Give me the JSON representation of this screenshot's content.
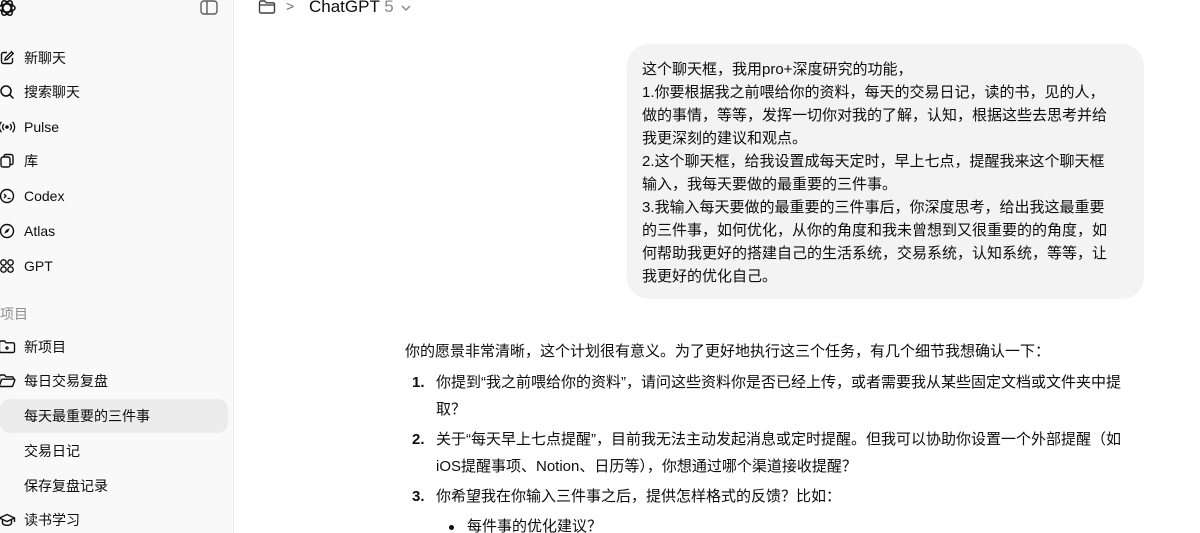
{
  "header": {
    "model_name": "ChatGPT",
    "model_version": "5",
    "breadcrumb_separator": ">"
  },
  "sidebar": {
    "nav": [
      {
        "label": "新聊天",
        "icon": "new-chat-icon"
      },
      {
        "label": "搜索聊天",
        "icon": "search-icon"
      },
      {
        "label": "Pulse",
        "icon": "pulse-icon"
      },
      {
        "label": "库",
        "icon": "library-icon"
      },
      {
        "label": "Codex",
        "icon": "codex-icon"
      },
      {
        "label": "Atlas",
        "icon": "atlas-icon"
      },
      {
        "label": "GPT",
        "icon": "gpt-icon"
      }
    ],
    "projects_heading": "项目",
    "projects": [
      {
        "label": "新项目",
        "icon": "new-project-icon"
      },
      {
        "label": "每日交易复盘",
        "icon": "folder-open-icon"
      },
      {
        "label": "每天最重要的三件事",
        "active": true
      },
      {
        "label": "交易日记"
      },
      {
        "label": "保存复盘记录"
      },
      {
        "label": "读书学习",
        "icon": "graduation-cap-icon"
      }
    ]
  },
  "conversation": {
    "user_message_lines": [
      "这个聊天框，我用pro+深度研究的功能，",
      "1.你要根据我之前喂给你的资料，每天的交易日记，读的书，见的人，",
      "做的事情，等等，发挥一切你对我的了解，认知，根据这些去思考并给",
      "我更深刻的建议和观点。",
      "2.这个聊天框，给我设置成每天定时，早上七点，提醒我来这个聊天框",
      "输入，我每天要做的最重要的三件事。",
      "3.我输入每天要做的最重要的三件事后，你深度思考，给出我这最重要",
      "的三件事，如何优化，从你的角度和我未曾想到又很重要的的角度，如",
      "何帮助我更好的搭建自己的生活系统，交易系统，认知系统，等等，让",
      "我更好的优化自己。"
    ],
    "assistant_intro": "你的愿景非常清晰，这个计划很有意义。为了更好地执行这三个任务，有几个细节我想确认一下：",
    "assistant_items": [
      {
        "number": "1.",
        "lines": [
          "你提到“我之前喂给你的资料”，请问这些资料你是否已经上传，或者需要我从某些固定文档或文件夹中提",
          "取？"
        ]
      },
      {
        "number": "2.",
        "lines": [
          "关于“每天早上七点提醒”，目前我无法主动发起消息或定时提醒。但我可以协助你设置一个外部提醒（如",
          "iOS提醒事项、Notion、日历等），你想通过哪个渠道接收提醒？"
        ]
      },
      {
        "number": "3.",
        "lines": [
          "你希望我在你输入三件事之后，提供怎样格式的反馈？比如："
        ]
      }
    ],
    "assistant_subitems": [
      "每件事的优化建议？"
    ]
  }
}
